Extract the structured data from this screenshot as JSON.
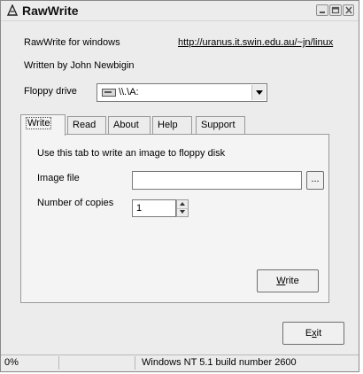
{
  "window": {
    "title": "RawWrite"
  },
  "info": {
    "app_name": "RawWrite for windows",
    "url": "http://uranus.it.swin.edu.au/~jn/linux",
    "author": "Written by John Newbigin"
  },
  "floppy": {
    "label": "Floppy drive",
    "selected": "\\\\.\\A:",
    "icon": "floppy-drive-icon"
  },
  "tabs": [
    {
      "label": "Write",
      "active": true
    },
    {
      "label": "Read",
      "active": false
    },
    {
      "label": "About",
      "active": false
    },
    {
      "label": "Help",
      "active": false
    },
    {
      "label": "Support",
      "active": false
    }
  ],
  "write_tab": {
    "instruction": "Use this tab to write an image to floppy disk",
    "image_file_label": "Image file",
    "image_file_value": "",
    "browse_label": "...",
    "copies_label": "Number of copies",
    "copies_value": "1",
    "write_button": "Write",
    "write_button_accel": "W"
  },
  "exit_button": "Exit",
  "exit_button_accel": "x",
  "status": {
    "progress": "0%",
    "cell2": "",
    "os_info": "Windows NT 5.1 build number 2600"
  }
}
